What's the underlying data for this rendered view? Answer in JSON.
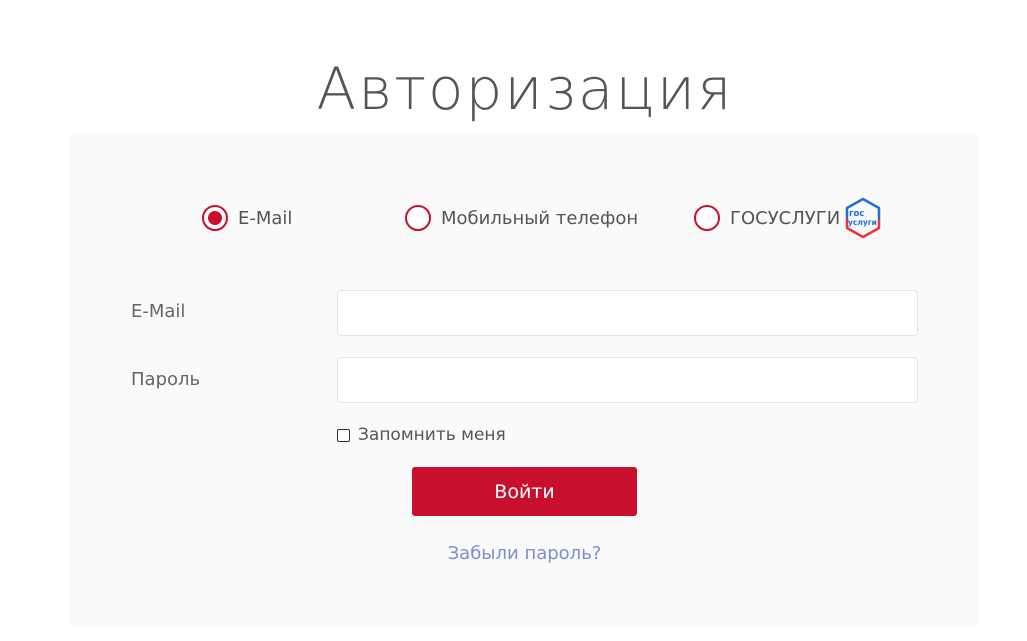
{
  "page": {
    "title": "Авторизация"
  },
  "auth_methods": {
    "selected": "email",
    "options": [
      {
        "id": "email",
        "label": "E-Mail"
      },
      {
        "id": "phone",
        "label": "Мобильный телефон"
      },
      {
        "id": "gosuslugi",
        "label": "ГОСУСЛУГИ"
      }
    ],
    "gos_logo": {
      "line1": "гос",
      "line2": "услуги",
      "colors": {
        "blue": "#1e6fd9",
        "red": "#e8333a"
      }
    }
  },
  "form": {
    "email_label": "E-Mail",
    "email_value": "",
    "password_label": "Пароль",
    "password_value": "",
    "remember_label": "Запомнить меня",
    "remember_checked": false,
    "submit_label": "Войти",
    "forgot_label": "Забыли пароль?"
  },
  "colors": {
    "accent": "#c8102e",
    "link": "#7b8ed1",
    "card_bg": "#fafafa",
    "text": "#555555"
  }
}
